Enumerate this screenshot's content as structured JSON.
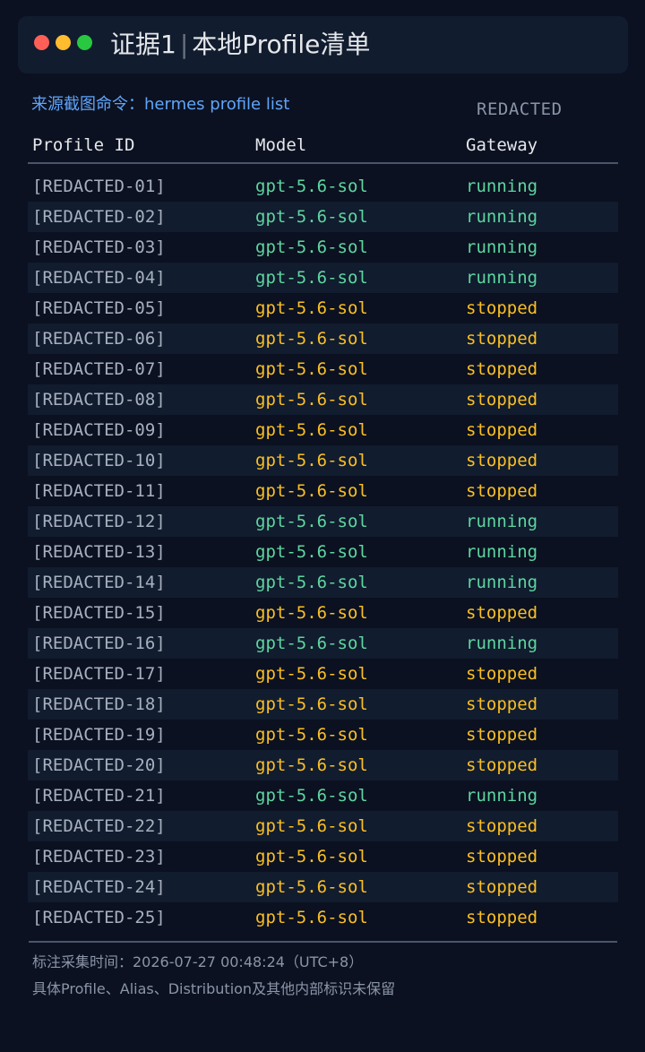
{
  "window": {
    "title_prefix": "证据1",
    "title_separator": "|",
    "title_main": "本地Profile清单",
    "colors": {
      "close": "#ff5f57",
      "minimize": "#febc2e",
      "maximize": "#28c840"
    }
  },
  "source": {
    "label": "来源截图命令：hermes profile list"
  },
  "redacted_tag": "REDACTED",
  "table": {
    "headers": {
      "profile_id": "Profile ID",
      "model": "Model",
      "gateway": "Gateway"
    },
    "status_colors": {
      "running": "#5ed6a0",
      "stopped": "#fbbf24"
    },
    "rows": [
      {
        "id": "[REDACTED-01]",
        "model": "gpt-5.6-sol",
        "gateway": "running"
      },
      {
        "id": "[REDACTED-02]",
        "model": "gpt-5.6-sol",
        "gateway": "running"
      },
      {
        "id": "[REDACTED-03]",
        "model": "gpt-5.6-sol",
        "gateway": "running"
      },
      {
        "id": "[REDACTED-04]",
        "model": "gpt-5.6-sol",
        "gateway": "running"
      },
      {
        "id": "[REDACTED-05]",
        "model": "gpt-5.6-sol",
        "gateway": "stopped"
      },
      {
        "id": "[REDACTED-06]",
        "model": "gpt-5.6-sol",
        "gateway": "stopped"
      },
      {
        "id": "[REDACTED-07]",
        "model": "gpt-5.6-sol",
        "gateway": "stopped"
      },
      {
        "id": "[REDACTED-08]",
        "model": "gpt-5.6-sol",
        "gateway": "stopped"
      },
      {
        "id": "[REDACTED-09]",
        "model": "gpt-5.6-sol",
        "gateway": "stopped"
      },
      {
        "id": "[REDACTED-10]",
        "model": "gpt-5.6-sol",
        "gateway": "stopped"
      },
      {
        "id": "[REDACTED-11]",
        "model": "gpt-5.6-sol",
        "gateway": "stopped"
      },
      {
        "id": "[REDACTED-12]",
        "model": "gpt-5.6-sol",
        "gateway": "running"
      },
      {
        "id": "[REDACTED-13]",
        "model": "gpt-5.6-sol",
        "gateway": "running"
      },
      {
        "id": "[REDACTED-14]",
        "model": "gpt-5.6-sol",
        "gateway": "running"
      },
      {
        "id": "[REDACTED-15]",
        "model": "gpt-5.6-sol",
        "gateway": "stopped"
      },
      {
        "id": "[REDACTED-16]",
        "model": "gpt-5.6-sol",
        "gateway": "running"
      },
      {
        "id": "[REDACTED-17]",
        "model": "gpt-5.6-sol",
        "gateway": "stopped"
      },
      {
        "id": "[REDACTED-18]",
        "model": "gpt-5.6-sol",
        "gateway": "stopped"
      },
      {
        "id": "[REDACTED-19]",
        "model": "gpt-5.6-sol",
        "gateway": "stopped"
      },
      {
        "id": "[REDACTED-20]",
        "model": "gpt-5.6-sol",
        "gateway": "stopped"
      },
      {
        "id": "[REDACTED-21]",
        "model": "gpt-5.6-sol",
        "gateway": "running"
      },
      {
        "id": "[REDACTED-22]",
        "model": "gpt-5.6-sol",
        "gateway": "stopped"
      },
      {
        "id": "[REDACTED-23]",
        "model": "gpt-5.6-sol",
        "gateway": "stopped"
      },
      {
        "id": "[REDACTED-24]",
        "model": "gpt-5.6-sol",
        "gateway": "stopped"
      },
      {
        "id": "[REDACTED-25]",
        "model": "gpt-5.6-sol",
        "gateway": "stopped"
      }
    ]
  },
  "footer": {
    "line1": "标注采集时间：2026-07-27 00:48:24（UTC+8）",
    "line2": "具体Profile、Alias、Distribution及其他内部标识未保留"
  }
}
